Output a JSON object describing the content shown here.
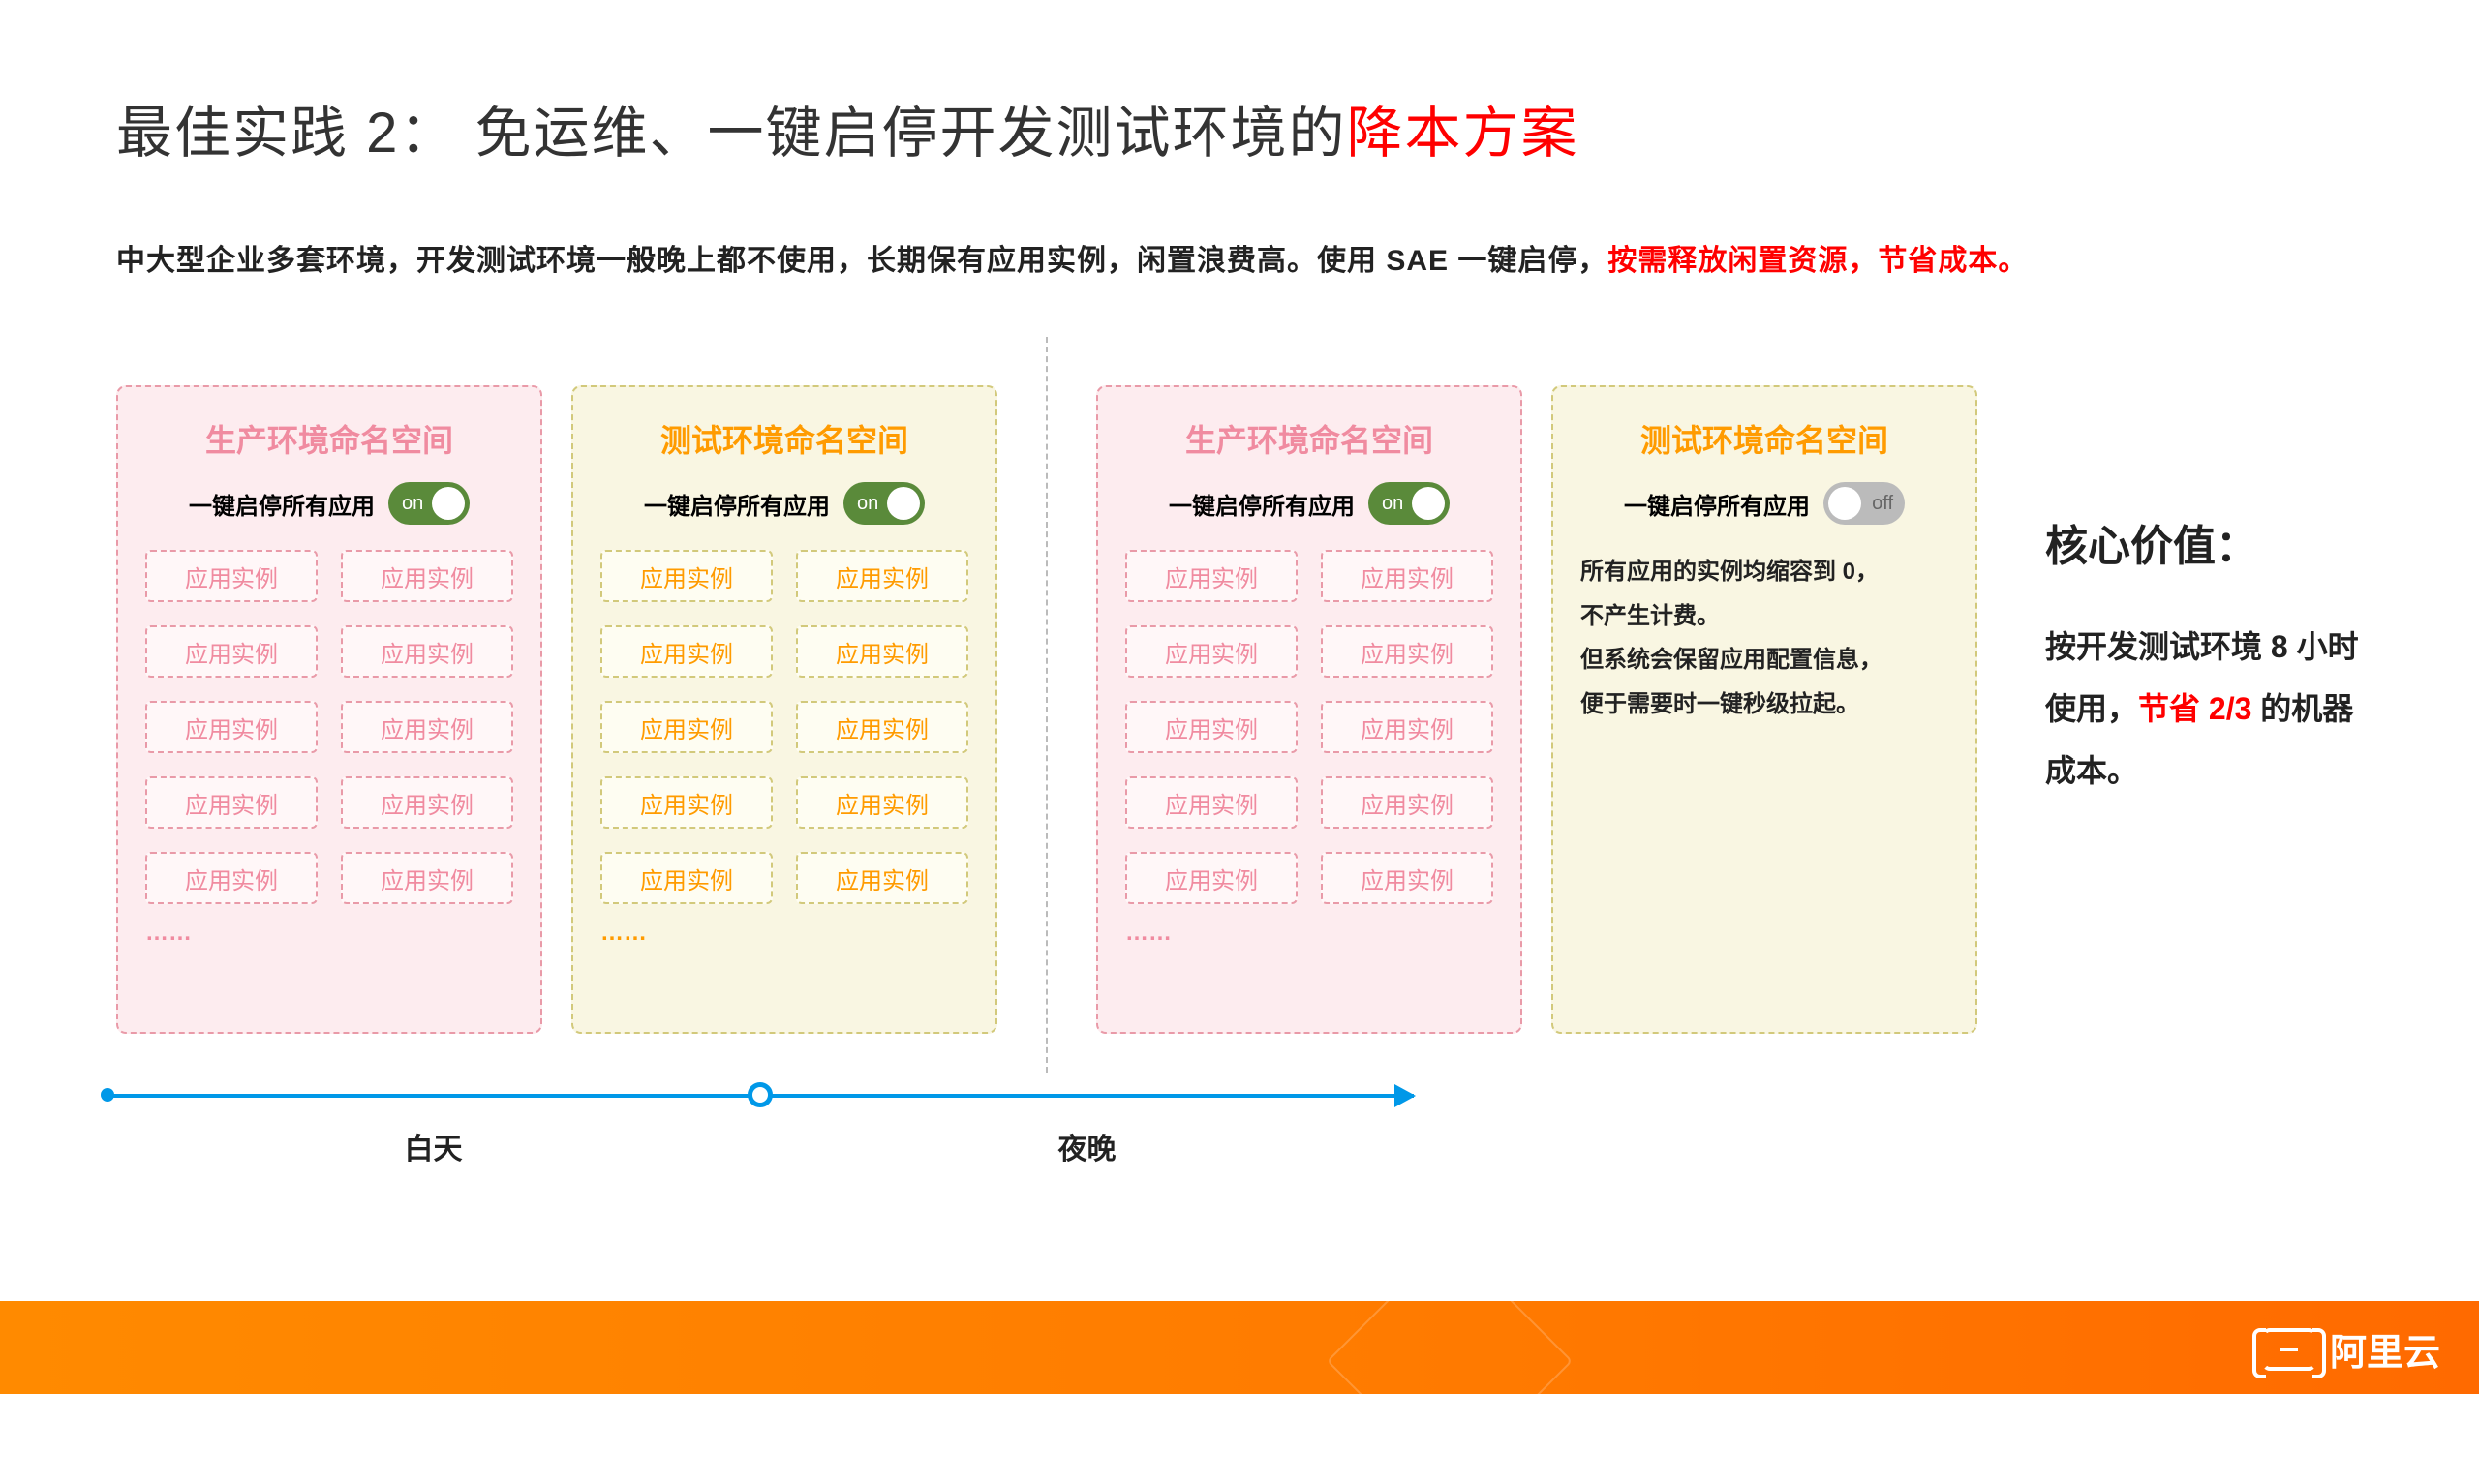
{
  "title_prefix": "最佳实践 2： 免运维、一键启停开发测试环境的",
  "title_accent": "降本方案",
  "subtitle_prefix": "中大型企业多套环境，开发测试环境一般晚上都不使用，长期保有应用实例，闲置浪费高。使用 SAE 一键启停，",
  "subtitle_accent": "按需释放闲置资源，节省成本。",
  "panel": {
    "prod_title": "生产环境命名空间",
    "test_title": "测试环境命名空间",
    "toggle_label": "一键启停所有应用",
    "toggle_on": "on",
    "toggle_off": "off",
    "instance_label": "应用实例",
    "ellipsis": "……"
  },
  "off_desc_l1": "所有应用的实例均缩容到 0，",
  "off_desc_l2": "不产生计费。",
  "off_desc_l3": "但系统会保留应用配置信息，",
  "off_desc_l4": "便于需要时一键秒级拉起。",
  "timeline": {
    "day": "白天",
    "night": "夜晚"
  },
  "core_value": {
    "title": "核心价值：",
    "body_prefix": "按开发测试环境 8 小时使用，",
    "body_accent": "节省 2/3",
    "body_suffix": " 的机器成本。"
  },
  "footer": {
    "brand": "阿里云"
  }
}
